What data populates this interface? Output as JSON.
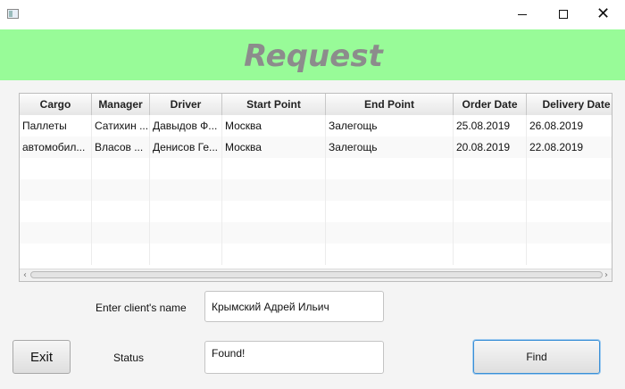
{
  "window": {
    "icon": "app-window-icon",
    "controls": {
      "minimize": "minimize-icon",
      "maximize": "maximize-icon",
      "close": "✕"
    }
  },
  "header": {
    "title": "Request",
    "band_color": "#98fb98",
    "title_color": "#8c8c8c"
  },
  "table": {
    "columns": [
      "Cargo",
      "Manager",
      "Driver",
      "Start Point",
      "End Point",
      "Order Date",
      "Delivery Date"
    ],
    "rows": [
      [
        "Паллеты",
        "Сатихин ...",
        "Давыдов Ф...",
        "Москва",
        "Залегощь",
        "25.08.2019",
        "26.08.2019"
      ],
      [
        "автомобил...",
        "Власов ...",
        "Денисов Ге...",
        "Москва",
        "Залегощь",
        "20.08.2019",
        "22.08.2019"
      ],
      [
        "",
        "",
        "",
        "",
        "",
        "",
        ""
      ],
      [
        "",
        "",
        "",
        "",
        "",
        "",
        ""
      ],
      [
        "",
        "",
        "",
        "",
        "",
        "",
        ""
      ],
      [
        "",
        "",
        "",
        "",
        "",
        "",
        ""
      ],
      [
        "",
        "",
        "",
        "",
        "",
        "",
        ""
      ]
    ]
  },
  "form": {
    "name_label": "Enter client's name",
    "name_value": "Крымский Адрей Ильич",
    "status_label": "Status",
    "status_value": "Found!"
  },
  "buttons": {
    "exit": "Exit",
    "find": "Find"
  }
}
